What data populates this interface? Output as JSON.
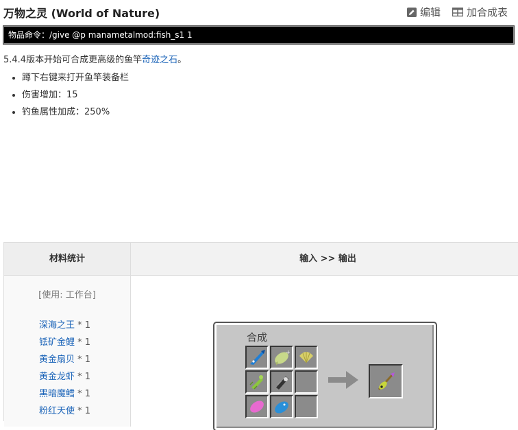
{
  "header": {
    "title": "万物之灵 (World of Nature)",
    "edit_label": "编辑",
    "add_recipe_label": "加合成表"
  },
  "command_bar": "物品命令：/give @p manametalmod:fish_s1 1",
  "intro": {
    "text": "5.4.4版本开始可合成更高级的鱼竿",
    "link": "奇迹之石",
    "suffix": "。"
  },
  "features": [
    "蹲下右键来打开鱼竿装备栏",
    "伤害增加：15",
    "钓鱼属性加成：250%"
  ],
  "recipe_table": {
    "col1_header": "材料统计",
    "col2_header": "输入 >> 输出",
    "station": "[使用: 工作台]",
    "materials": [
      {
        "name": "深海之王",
        "qty": " * 1"
      },
      {
        "name": "铥矿金鲤",
        "qty": " * 1"
      },
      {
        "name": "黄金扇贝",
        "qty": " * 1"
      },
      {
        "name": "黄金龙虾",
        "qty": " * 1"
      },
      {
        "name": "黑暗魔鳕",
        "qty": " * 1"
      },
      {
        "name": "粉红天使",
        "qty": " * 1"
      }
    ],
    "crafting": {
      "label": "合成",
      "grid": [
        "blue-fish-icon",
        "golden-carp-icon",
        "golden-scallop-icon",
        "golden-lobster-icon",
        "dark-cod-icon",
        "empty",
        "pink-angel-icon",
        "blue-fish-2-icon",
        "empty"
      ],
      "output": "fishing-rod-icon"
    }
  }
}
